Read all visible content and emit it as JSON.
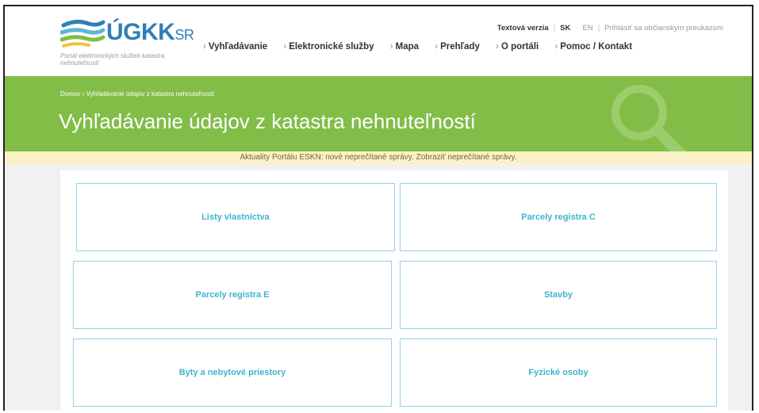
{
  "logo": {
    "wordmark": "ÚGKK",
    "suffix": "SR",
    "subtitle": "Portál elektronických služieb katastra nehnuteľností"
  },
  "toplinks": {
    "text_version": "Textová verzia",
    "lang_sk": "SK",
    "lang_en": "EN",
    "login": "Prihlásiť sa občianskym preukazom"
  },
  "nav": {
    "items": [
      {
        "label": "Vyhľadávanie"
      },
      {
        "label": "Elektronické služby"
      },
      {
        "label": "Mapa"
      },
      {
        "label": "Prehľady"
      },
      {
        "label": "O portáli"
      },
      {
        "label": "Pomoc / Kontakt"
      }
    ]
  },
  "banner": {
    "breadcrumb": "Domov › Vyhľadávanie údajov z katastra nehnuteľností",
    "title": "Vyhľadávanie údajov z katastra nehnuteľností"
  },
  "news": {
    "text": "Aktuality Portálu ESKN: nové neprečítané správy.",
    "link": "Zobraziť neprečítané správy."
  },
  "tiles": [
    {
      "label": "Listy vlastníctva"
    },
    {
      "label": "Parcely registra C"
    },
    {
      "label": "Parcely registra E"
    },
    {
      "label": "Stavby"
    },
    {
      "label": "Byty a nebytové priestory"
    },
    {
      "label": "Fyzické osoby"
    }
  ],
  "colors": {
    "banner_green": "#82bd48",
    "tile_text": "#3db4d0",
    "tile_border": "#8fd3e6",
    "logo_blue": "#2f7fb8",
    "news_bg": "#fbf1c6"
  }
}
